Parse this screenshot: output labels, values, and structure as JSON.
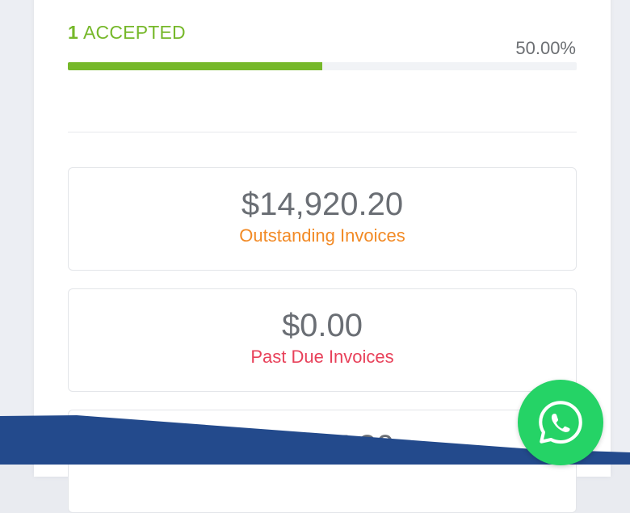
{
  "accepted": {
    "count": "1",
    "label": "ACCEPTED",
    "percent_text": "50.00%",
    "progress_fraction": 0.5
  },
  "stats": [
    {
      "amount": "$14,920.20",
      "caption": "Outstanding Invoices"
    },
    {
      "amount": "$0.00",
      "caption": "Past Due Invoices"
    },
    {
      "amount": "$6,667.30",
      "caption": ""
    }
  ],
  "colors": {
    "accent_green": "#76b82a",
    "outstanding_orange": "#f28a25",
    "past_due_red": "#e8415a",
    "banner_blue": "#234a8c",
    "whatsapp_green": "#25d366"
  },
  "icons": {
    "chat_button": "whatsapp-icon"
  }
}
